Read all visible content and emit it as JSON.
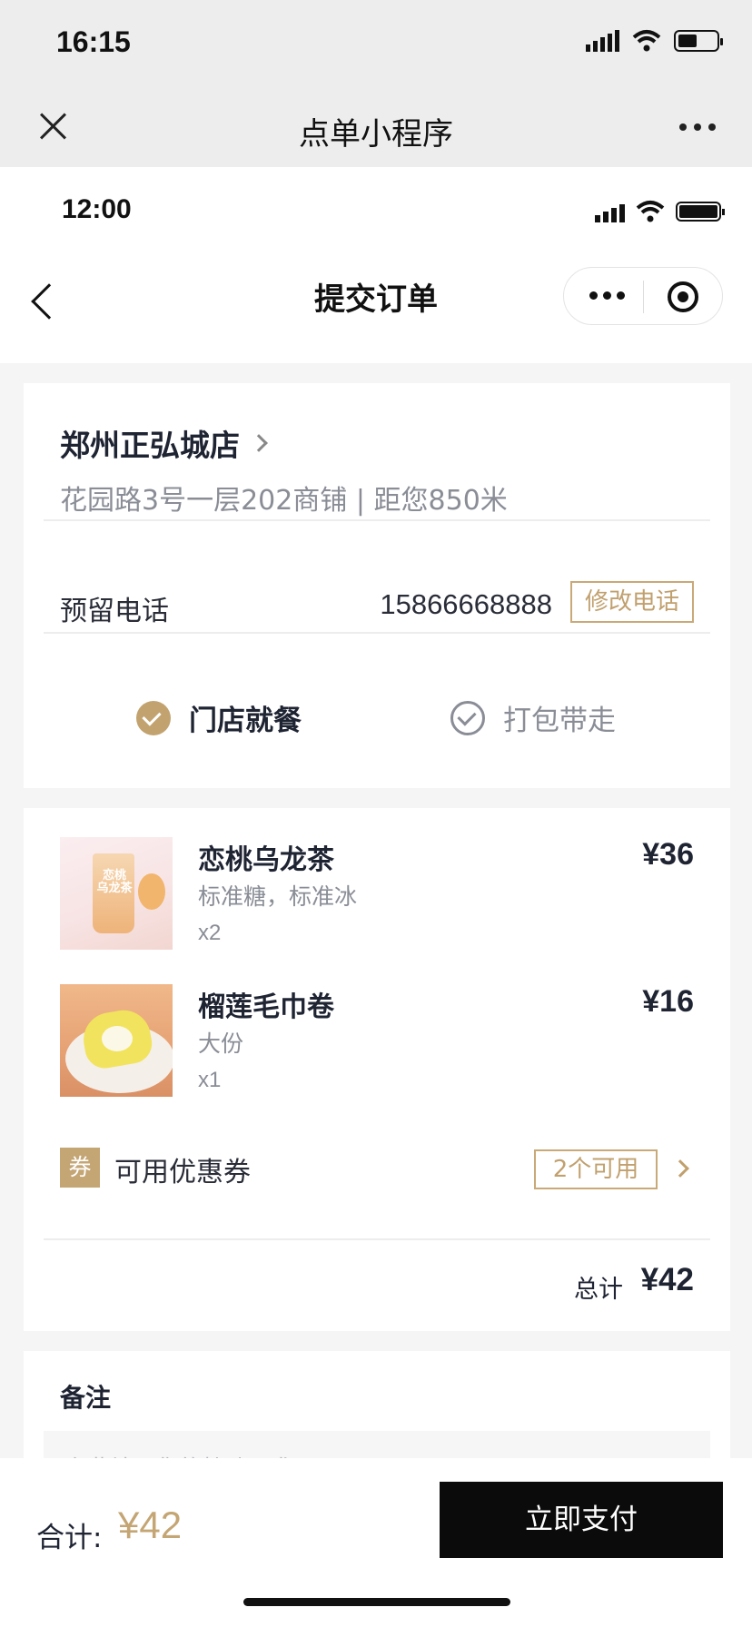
{
  "outer_status": {
    "time": "16:15"
  },
  "mini_program": {
    "title": "点单小程序"
  },
  "inner_status": {
    "time": "12:00"
  },
  "navbar": {
    "title": "提交订单"
  },
  "store": {
    "name": "郑州正弘城店",
    "address": "花园路3号一层202商铺 | 距您850米"
  },
  "contact": {
    "label": "预留电话",
    "phone": "15866668888",
    "edit_button": "修改电话"
  },
  "dining_options": {
    "dine_in": "门店就餐",
    "takeaway": "打包带走",
    "selected": "dine_in"
  },
  "items": [
    {
      "name": "恋桃乌龙茶",
      "spec": "标准糖，标准冰",
      "qty": "x2",
      "price": "¥36",
      "image_text": "恋桃乌龙茶"
    },
    {
      "name": "榴莲毛巾卷",
      "spec": "大份",
      "qty": "x1",
      "price": "¥16"
    }
  ],
  "coupon": {
    "icon_text": "券",
    "label": "可用优惠券",
    "count": "2个可用"
  },
  "subtotal": {
    "label": "总计",
    "value": "¥42"
  },
  "remarks": {
    "title": "备注",
    "placeholder": "在此填写您的特殊需求"
  },
  "footer": {
    "total_label": "合计:",
    "total_value": "¥42",
    "pay_button": "立即支付"
  },
  "colors": {
    "accent": "#c4a574",
    "text": "#1f2433",
    "muted": "#8a8d96",
    "button": "#0b0b0b"
  }
}
